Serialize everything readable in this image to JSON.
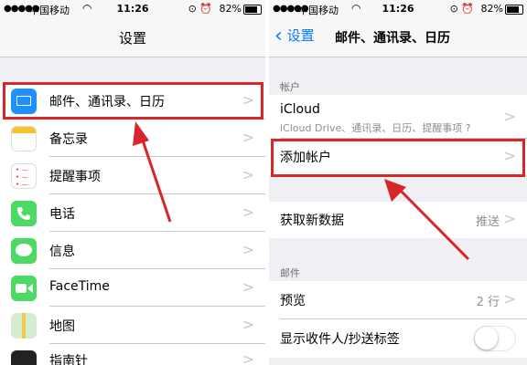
{
  "status_left": {
    "signal": "●●●●●",
    "carrier": "中国移动",
    "time": "11:26",
    "battery": "82%"
  },
  "status_right": {
    "signal": "●●●●●",
    "carrier": "中国移动",
    "time": "11:26",
    "battery": "82%"
  },
  "settings": {
    "title": "设置",
    "items": [
      {
        "label": "邮件、通讯录、日历",
        "icon": "mail-icon"
      },
      {
        "label": "备忘录",
        "icon": "notes-icon"
      },
      {
        "label": "提醒事项",
        "icon": "reminders-icon"
      },
      {
        "label": "电话",
        "icon": "phone-icon"
      },
      {
        "label": "信息",
        "icon": "messages-icon"
      },
      {
        "label": "FaceTime",
        "icon": "facetime-icon"
      },
      {
        "label": "地图",
        "icon": "maps-icon"
      },
      {
        "label": "指南针",
        "icon": "compass-icon"
      }
    ]
  },
  "mail": {
    "back_label": "设置",
    "title": "邮件、通讯录、日历",
    "accounts_header": "帐户",
    "icloud_label": "iCloud",
    "icloud_sub": "iCloud Drive、通讯录、日历、提醒事项 ?",
    "add_account": "添加帐户",
    "fetch_label": "获取新数据",
    "fetch_value": "推送",
    "mail_header": "邮件",
    "preview_label": "预览",
    "preview_value": "2 行",
    "show_tocc_label": "显示收件人/抄送标签",
    "show_tocc_on": false
  },
  "colors": {
    "highlight": "#d9262b",
    "ios_blue": "#007aff",
    "background": "#efeff4"
  }
}
